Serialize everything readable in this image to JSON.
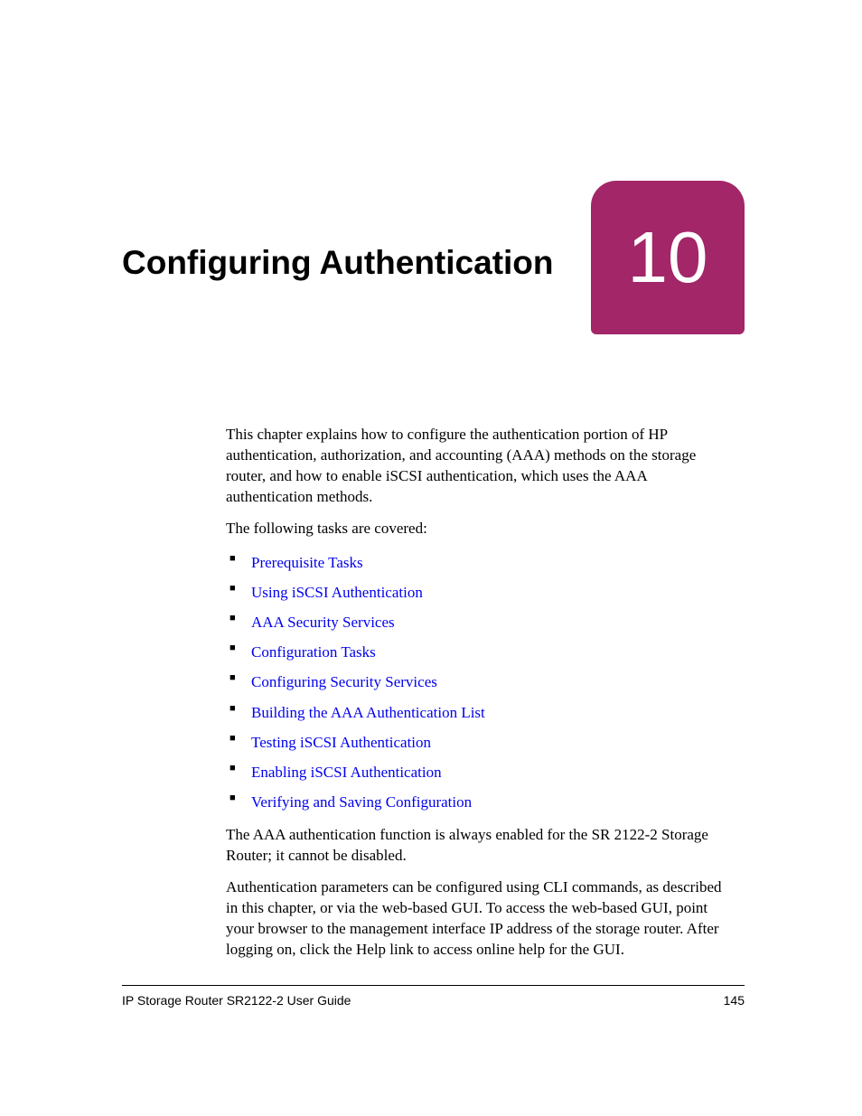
{
  "chapter": {
    "title": "Configuring Authentication",
    "number": "10"
  },
  "intro": "This chapter explains how to configure the authentication portion of HP authentication, authorization, and accounting (AAA) methods on the storage router, and how to enable iSCSI authentication, which uses the AAA authentication methods.",
  "tasks_lead": "The following tasks are covered:",
  "tasks": [
    "Prerequisite Tasks",
    "Using iSCSI Authentication",
    "AAA Security Services",
    "Configuration Tasks",
    "Configuring Security Services",
    "Building the AAA Authentication List",
    "Testing iSCSI Authentication",
    "Enabling iSCSI Authentication",
    "Verifying and Saving Configuration"
  ],
  "note1": "The AAA authentication function is always enabled for the SR 2122-2 Storage Router; it cannot be disabled.",
  "note2": "Authentication parameters can be configured using CLI commands, as described in this chapter, or via the web-based GUI. To access the web-based GUI, point your browser to the management interface IP address of the storage router. After logging on, click the Help link to access online help for the GUI.",
  "footer": {
    "doc_title": "IP Storage Router SR2122-2 User Guide",
    "page_number": "145"
  }
}
